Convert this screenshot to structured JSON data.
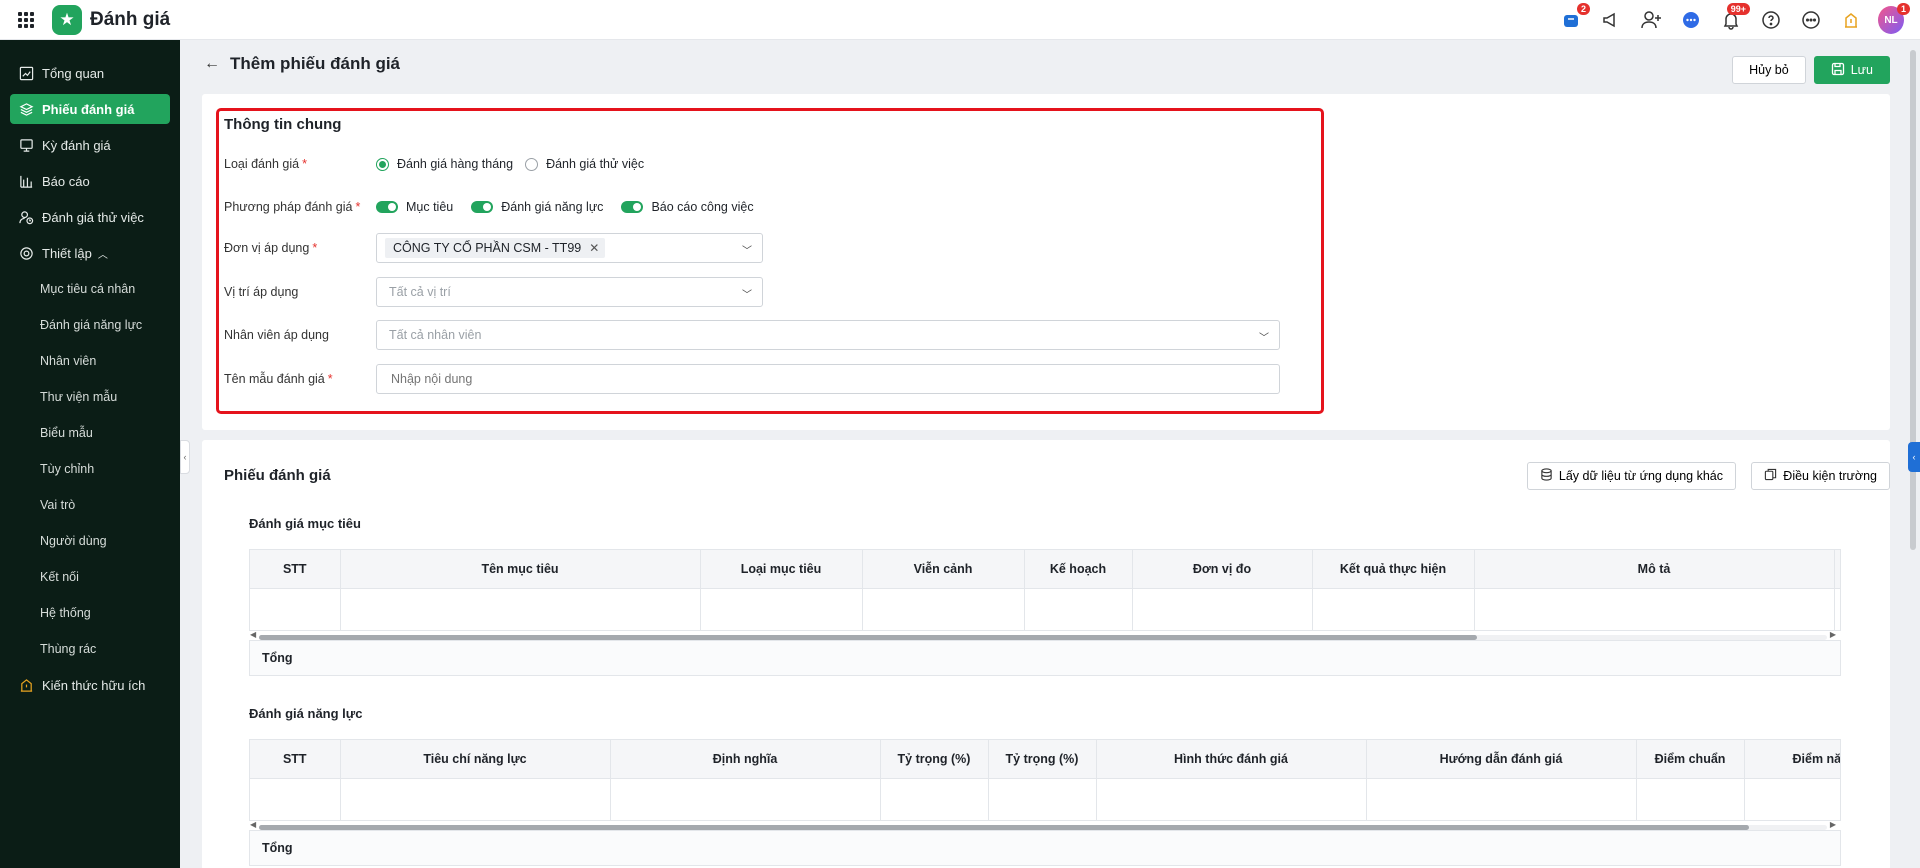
{
  "app": {
    "title": "Đánh giá"
  },
  "topbar": {
    "icons": [
      {
        "name": "cart-icon",
        "badge": "2"
      },
      {
        "name": "megaphone-icon",
        "badge": ""
      },
      {
        "name": "add-user-icon",
        "badge": ""
      },
      {
        "name": "chat-icon",
        "badge": ""
      },
      {
        "name": "bell-icon",
        "badge": "99+"
      },
      {
        "name": "help-icon",
        "badge": ""
      },
      {
        "name": "more-icon",
        "badge": ""
      },
      {
        "name": "lightbulb-icon",
        "badge": ""
      }
    ],
    "avatar_initials": "NL",
    "avatar_badge": "1"
  },
  "sidebar": {
    "items": [
      {
        "label": "Tổng quan",
        "icon": "chart-icon"
      },
      {
        "label": "Phiếu đánh giá",
        "icon": "layers-icon",
        "active": true
      },
      {
        "label": "Kỳ đánh giá",
        "icon": "calendar-icon"
      },
      {
        "label": "Báo cáo",
        "icon": "bar-chart-icon"
      },
      {
        "label": "Đánh giá thử việc",
        "icon": "user-probation-icon"
      },
      {
        "label": "Thiết lập",
        "icon": "gear-icon"
      }
    ],
    "sub_items": [
      "Mục tiêu cá nhân",
      "Đánh giá năng lực",
      "Nhân viên",
      "Thư viện mẫu",
      "Biểu mẫu",
      "Tùy chỉnh",
      "Vai trò",
      "Người dùng",
      "Kết nối",
      "Hệ thống",
      "Thùng rác"
    ],
    "footer_item": "Kiến thức hữu ích"
  },
  "page": {
    "title": "Thêm phiếu đánh giá",
    "cancel_label": "Hủy bỏ",
    "save_label": "Lưu"
  },
  "general": {
    "title": "Thông tin chung",
    "type_label": "Loại đánh giá",
    "type_options": [
      "Đánh giá hàng tháng",
      "Đánh giá thử việc"
    ],
    "method_label": "Phương pháp đánh giá",
    "method_options": [
      "Mục tiêu",
      "Đánh giá năng lực",
      "Báo cáo công việc"
    ],
    "unit_label": "Đơn vị áp dụng",
    "unit_tag": "CÔNG TY CỔ PHẦN CSM - TT99",
    "position_label": "Vị trí áp dụng",
    "position_placeholder": "Tất cả vị trí",
    "employee_label": "Nhân viên áp dụng",
    "employee_placeholder": "Tất cả nhân viên",
    "template_label": "Tên mẫu đánh giá",
    "template_placeholder": "Nhập nội dung"
  },
  "form": {
    "title": "Phiếu đánh giá",
    "import_label": "Lấy dữ liệu từ ứng dụng khác",
    "conditions_label": "Điều kiện trường",
    "goals": {
      "title": "Đánh giá mục tiêu",
      "columns": [
        "STT",
        "Tên mục tiêu",
        "Loại mục tiêu",
        "Viễn cảnh",
        "Kế hoạch",
        "Đơn vị đo",
        "Kết quả thực hiện",
        "Mô tả"
      ],
      "total_label": "Tổng"
    },
    "competency": {
      "title": "Đánh giá năng lực",
      "columns": [
        "STT",
        "Tiêu chí năng lực",
        "Định nghĩa",
        "Tỷ trọng (%)",
        "Tỷ trọng (%)",
        "Hình thức đánh giá",
        "Hướng dẫn đánh giá",
        "Điểm chuẩn",
        "Điểm năng lực"
      ],
      "total_label": "Tổng"
    }
  }
}
